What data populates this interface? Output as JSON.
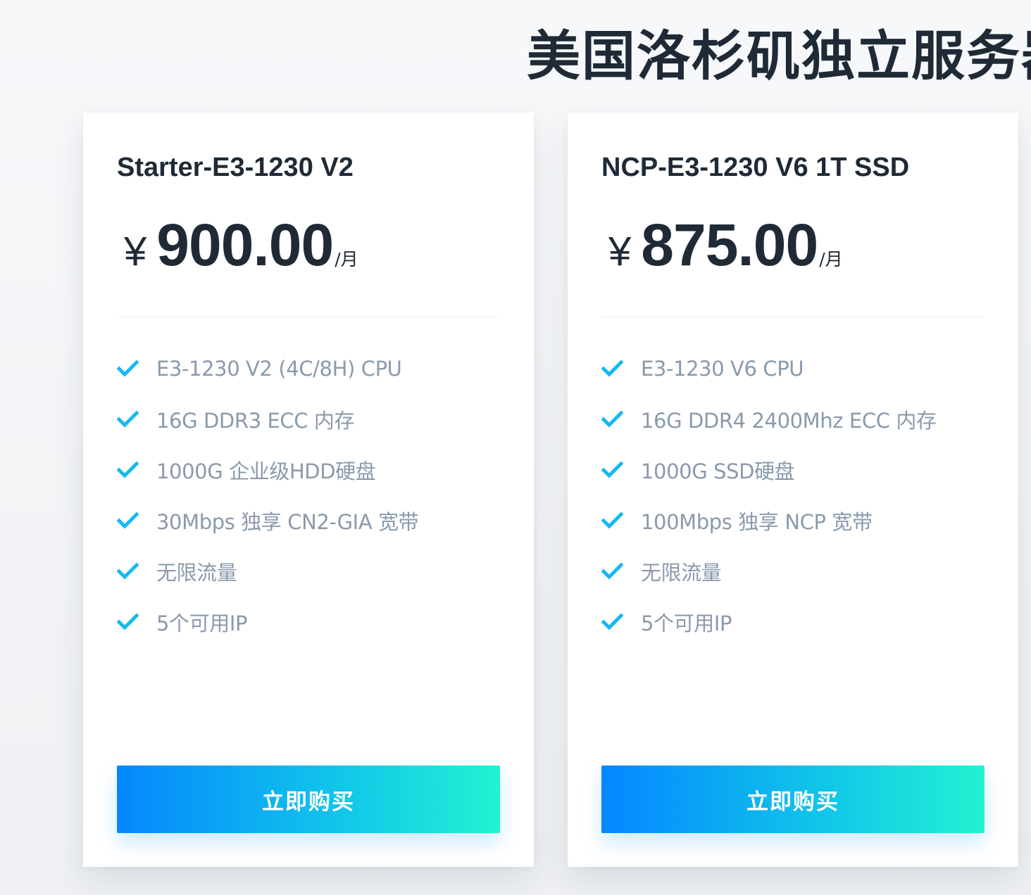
{
  "page": {
    "title": "美国洛杉矶独立服务器"
  },
  "plans": [
    {
      "name": "Starter-E3-1230 V2",
      "currency": "¥",
      "price": "900.00",
      "unit": "/月",
      "features": [
        "E3-1230 V2 (4C/8H) CPU",
        "16G DDR3 ECC 内存",
        "1000G 企业级HDD硬盘",
        "30Mbps 独享 CN2-GIA 宽带",
        "无限流量",
        "5个可用IP"
      ],
      "button_label": "立即购买"
    },
    {
      "name": "NCP-E3-1230 V6 1T SSD",
      "currency": "¥",
      "price": "875.00",
      "unit": "/月",
      "features": [
        "E3-1230 V6 CPU",
        "16G DDR4 2400Mhz ECC 内存",
        "1000G SSD硬盘",
        "100Mbps 独享 NCP 宽带",
        "无限流量",
        "5个可用IP"
      ],
      "button_label": "立即购买"
    }
  ],
  "icons": {
    "feature": "check-icon"
  },
  "colors": {
    "check": "#16b8f3",
    "heading": "#1f2a36",
    "feature_text": "#8a9aac",
    "button_start": "#0487ff",
    "button_end": "#22f2d2"
  }
}
